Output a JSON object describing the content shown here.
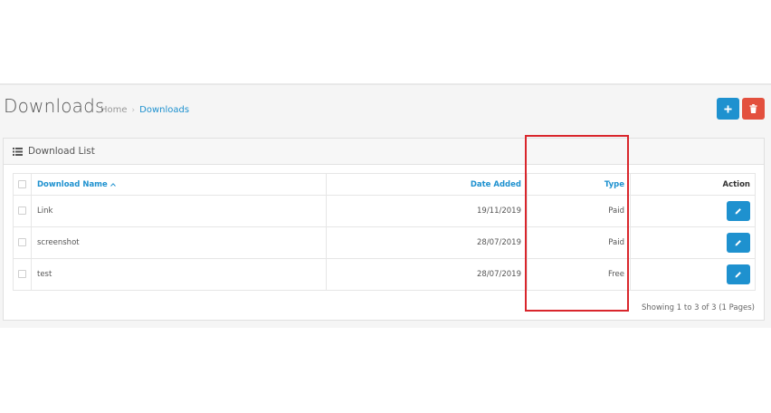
{
  "header": {
    "title": "Downloads",
    "breadcrumb": [
      {
        "label": "Home"
      },
      {
        "label": "Downloads"
      }
    ],
    "breadcrumb_separator": "›",
    "add_button_icon": "plus-icon",
    "delete_button_icon": "trash-icon"
  },
  "panel": {
    "title": "Download List",
    "icon": "list-icon"
  },
  "table": {
    "columns": {
      "name": "Download Name",
      "date": "Date Added",
      "type": "Type",
      "action": "Action"
    },
    "rows": [
      {
        "name": "Link",
        "date": "19/11/2019",
        "type": "Paid"
      },
      {
        "name": "screenshot",
        "date": "28/07/2019",
        "type": "Paid"
      },
      {
        "name": "test",
        "date": "28/07/2019",
        "type": "Free"
      }
    ]
  },
  "pagination": {
    "text": "Showing 1 to 3 of 3 (1 Pages)"
  },
  "colors": {
    "primary": "#1e91cf",
    "danger": "#e3503e",
    "highlight": "#d9262c"
  }
}
